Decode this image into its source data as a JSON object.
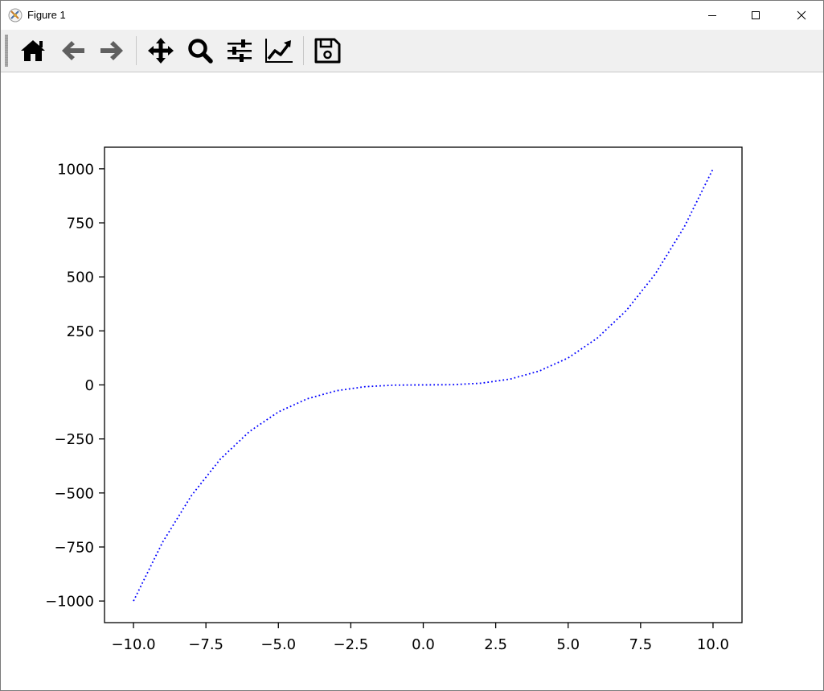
{
  "window": {
    "title": "Figure 1",
    "controls": {
      "minimize_icon": "minimize-icon",
      "maximize_icon": "maximize-icon",
      "close_icon": "close-icon"
    }
  },
  "toolbar": {
    "buttons": [
      {
        "id": "home",
        "icon": "home-icon"
      },
      {
        "id": "back",
        "icon": "arrow-left-icon"
      },
      {
        "id": "forward",
        "icon": "arrow-right-icon"
      },
      {
        "id": "pan",
        "icon": "move-icon"
      },
      {
        "id": "zoom",
        "icon": "magnifier-icon"
      },
      {
        "id": "subplots",
        "icon": "sliders-icon"
      },
      {
        "id": "customize",
        "icon": "line-chart-icon"
      },
      {
        "id": "save",
        "icon": "floppy-disk-icon"
      }
    ]
  },
  "chart_data": {
    "type": "line",
    "series": [
      {
        "color": "#0000ff",
        "line_style": "dotted",
        "x": [
          -10,
          -9,
          -8,
          -7,
          -6,
          -5,
          -4,
          -3,
          -2,
          -1,
          0,
          1,
          2,
          3,
          4,
          5,
          6,
          7,
          8,
          9,
          10
        ],
        "y": [
          -1000,
          -729,
          -512,
          -343,
          -216,
          -125,
          -64,
          -27,
          -8,
          -1,
          0,
          1,
          8,
          27,
          64,
          125,
          216,
          343,
          512,
          729,
          1000
        ]
      }
    ],
    "xlim": [
      -11,
      11
    ],
    "ylim": [
      -1100,
      1100
    ],
    "xticks": [
      -10,
      -7.5,
      -5,
      -2.5,
      0,
      2.5,
      5,
      7.5,
      10
    ],
    "xtick_labels": [
      "−10.0",
      "−7.5",
      "−5.0",
      "−2.5",
      "0.0",
      "2.5",
      "5.0",
      "7.5",
      "10.0"
    ],
    "yticks": [
      -1000,
      -750,
      -500,
      -250,
      0,
      250,
      500,
      750,
      1000
    ],
    "ytick_labels": [
      "−1000",
      "−750",
      "−500",
      "−250",
      "0",
      "250",
      "500",
      "750",
      "1000"
    ],
    "grid": false
  }
}
